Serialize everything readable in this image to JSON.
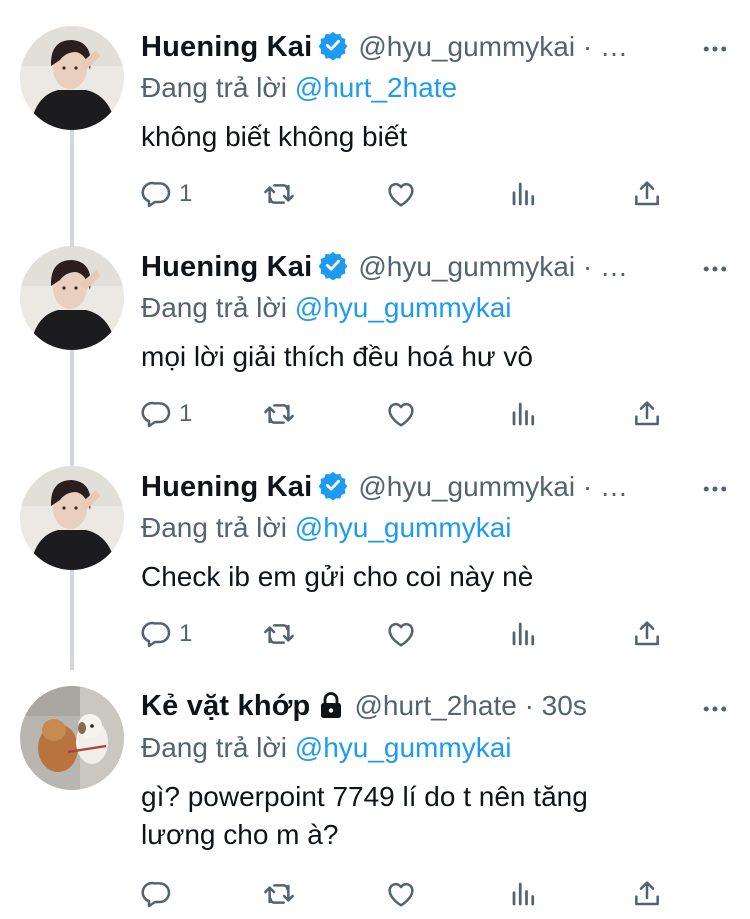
{
  "tweets": [
    {
      "name": "Huening Kai",
      "verified": true,
      "handle": "@hyu_gummykai · …",
      "reply_prefix": "Đang trả lời",
      "reply_to": "@hurt_2hate",
      "text": "không biết không biết",
      "reply_count": "1"
    },
    {
      "name": "Huening Kai",
      "verified": true,
      "handle": "@hyu_gummykai · …",
      "reply_prefix": "Đang trả lời",
      "reply_to": "@hyu_gummykai",
      "text": "mọi lời giải thích đều hoá hư vô",
      "reply_count": "1"
    },
    {
      "name": "Huening Kai",
      "verified": true,
      "handle": "@hyu_gummykai · …",
      "reply_prefix": "Đang trả lời",
      "reply_to": "@hyu_gummykai",
      "text": "Check ib em gửi cho coi này nè",
      "reply_count": "1"
    },
    {
      "name": "Kẻ vặt khớp",
      "protected": true,
      "handle": "@hurt_2hate · 30s",
      "reply_prefix": "Đang trả lời",
      "reply_to": "@hyu_gummykai",
      "text_line1": "gì? powerpoint 7749 lí do t nên tăng",
      "text_line2": "lương cho m à?",
      "reply_count": ""
    }
  ],
  "icons": {
    "verified": "verified-badge-icon",
    "lock": "lock-icon",
    "more": "more-icon",
    "reply": "reply-icon",
    "retweet": "retweet-icon",
    "like": "like-icon",
    "views": "views-icon",
    "share": "share-icon"
  },
  "colors": {
    "accent": "#1d9bf0",
    "secondary_text": "#536471",
    "primary_text": "#0f1419",
    "thread_line": "#cfd9de"
  }
}
